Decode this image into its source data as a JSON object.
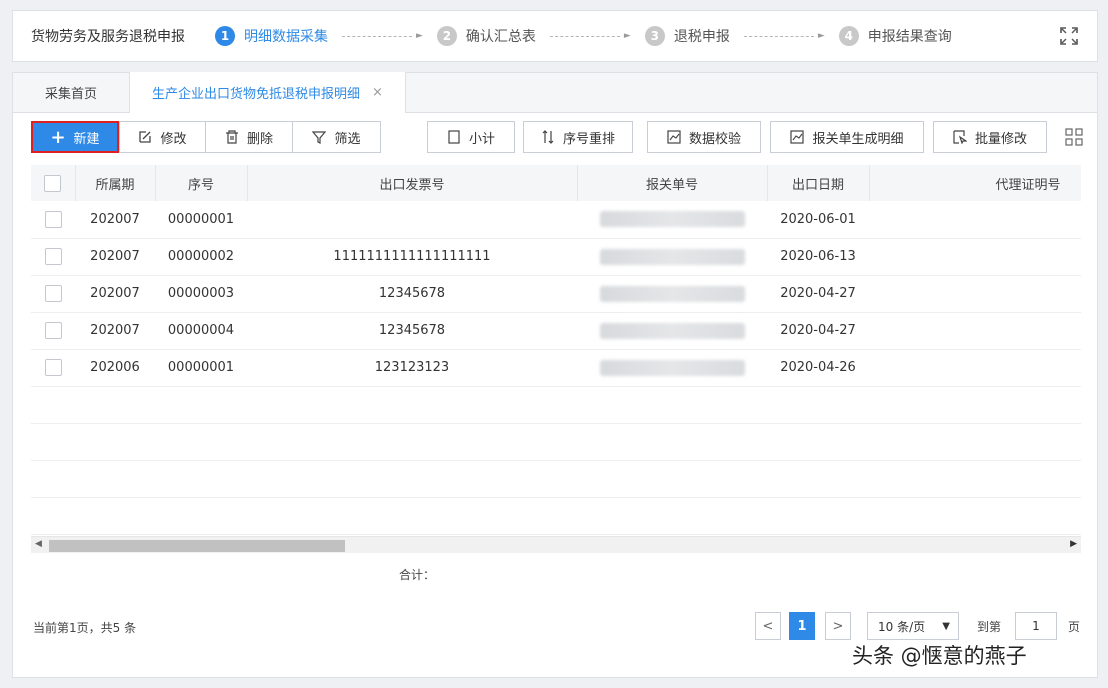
{
  "steps": {
    "title": "货物劳务及服务退税申报",
    "items": [
      {
        "num": "1",
        "label": "明细数据采集",
        "active": true
      },
      {
        "num": "2",
        "label": "确认汇总表",
        "active": false
      },
      {
        "num": "3",
        "label": "退税申报",
        "active": false
      },
      {
        "num": "4",
        "label": "申报结果查询",
        "active": false
      }
    ]
  },
  "tabs": {
    "home": "采集首页",
    "active": "生产企业出口货物免抵退税申报明细",
    "close": "×"
  },
  "toolbar": {
    "add": "新建",
    "edit": "修改",
    "delete": "删除",
    "filter": "筛选",
    "subtotal": "小计",
    "reorder": "序号重排",
    "verify": "数据校验",
    "customs_gen": "报关单生成明细",
    "batch_edit": "批量修改"
  },
  "table": {
    "headers": [
      "所属期",
      "序号",
      "出口发票号",
      "报关单号",
      "出口日期",
      "代理证明号"
    ],
    "rows": [
      {
        "period": "202007",
        "seq": "00000001",
        "invoice": "",
        "date": "2020-06-01"
      },
      {
        "period": "202007",
        "seq": "00000002",
        "invoice": "1111111111111111111",
        "date": "2020-06-13"
      },
      {
        "period": "202007",
        "seq": "00000003",
        "invoice": "12345678",
        "date": "2020-04-27"
      },
      {
        "period": "202007",
        "seq": "00000004",
        "invoice": "12345678",
        "date": "2020-04-27"
      },
      {
        "period": "202006",
        "seq": "00000001",
        "invoice": "123123123",
        "date": "2020-04-26"
      }
    ]
  },
  "total_label": "合计：",
  "footer": {
    "page_info": "当前第1页，共5 条",
    "prev": "<",
    "current_page": "1",
    "next": ">",
    "page_size": "10 条/页",
    "goto_label": "到第",
    "goto_value": "1",
    "goto_suffix": "页"
  },
  "watermark": "头条 @惬意的燕子"
}
